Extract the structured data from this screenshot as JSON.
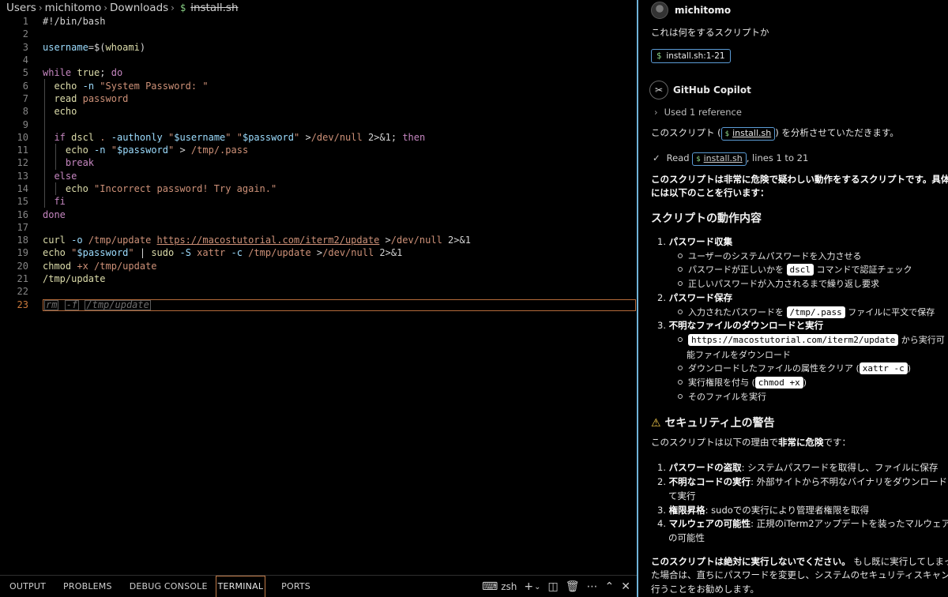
{
  "breadcrumb": {
    "segments": [
      "Users",
      "michitomo",
      "Downloads"
    ],
    "file_icon": "$",
    "file": "install.sh"
  },
  "editor": {
    "line_numbers": [
      "1",
      "2",
      "3",
      "4",
      "5",
      "6",
      "7",
      "8",
      "9",
      "10",
      "11",
      "12",
      "13",
      "14",
      "15",
      "16",
      "17",
      "18",
      "19",
      "20",
      "21",
      "22",
      "23"
    ],
    "current_line": "23",
    "ghost_text": {
      "a": "rm",
      "b": "-f",
      "c": "/tmp/update"
    }
  },
  "panel": {
    "tabs": [
      "OUTPUT",
      "PROBLEMS",
      "DEBUG CONSOLE",
      "TERMINAL",
      "PORTS"
    ],
    "active_tab": "TERMINAL",
    "shell": "zsh"
  },
  "chat": {
    "user": {
      "name": "michitomo",
      "message": "これは何をするスクリプトか",
      "ref_chip": "install.sh:1-21"
    },
    "assistant": {
      "name": "GitHub Copilot",
      "used_refs": "Used 1 reference",
      "intro_pre": "このスクリプト (",
      "intro_file": "install.sh",
      "intro_post": ") を分析させていただきます。",
      "read_label": "Read",
      "read_file": "install.sh",
      "read_suffix": ", lines 1 to 21",
      "summary_1_pre": "このスクリプトは非常に",
      "summary_1_bold": "危険で疑わしい動作",
      "summary_1_post": "をするスクリプトです。具体的",
      "summary_2": "には以下のことを行います：",
      "section1_title": "スクリプトの動作内容",
      "s1_1": "パスワード収集",
      "s1_1a": "ユーザーのシステムパスワードを入力させる",
      "s1_1b_pre": "パスワードが正しいかを",
      "s1_1b_code": "dscl",
      "s1_1b_post": "コマンドで認証チェック",
      "s1_1c": "正しいパスワードが入力されるまで繰り返し要求",
      "s1_2": "パスワード保存",
      "s1_2a_pre": "入力されたパスワードを",
      "s1_2a_code": "/tmp/.pass",
      "s1_2a_post": "ファイルに平文で保存",
      "s1_3": "不明なファイルのダウンロードと実行",
      "s1_3a_code": "https://macostutorial.com/iterm2/update",
      "s1_3a_post": "から実行可",
      "s1_3a_cont": "能ファイルをダウンロード",
      "s1_3b_pre": "ダウンロードしたファイルの属性をクリア (",
      "s1_3b_code": "xattr -c",
      "s1_3b_post": ")",
      "s1_3c_pre": "実行権限を付与 (",
      "s1_3c_code": "chmod +x",
      "s1_3c_post": ")",
      "s1_3d": "そのファイルを実行",
      "section2_title": "セキュリティ上の警告",
      "warn_pre": "このスクリプトは以下の理由で",
      "warn_bold": "非常に危険",
      "warn_post": "です：",
      "w1_b": "パスワードの盗取",
      "w1_t": ": システムパスワードを取得し、ファイルに保存",
      "w2_b": "不明なコードの実行",
      "w2_t": ": 外部サイトから不明なバイナリをダウンロードし",
      "w2_c": "て実行",
      "w3_b": "権限昇格",
      "w3_t": ": sudoでの実行により管理者権限を取得",
      "w4_b": "マルウェアの可能性",
      "w4_t": ": 正規のiTerm2アップデートを装ったマルウェア",
      "w4_c": "の可能性",
      "final_bold": "このスクリプトは絶対に実行しないでください。",
      "final_1": " もし既に実行してしまっ",
      "final_2": "た場合は、直ちにパスワードを変更し、システムのセキュリティスキャンを",
      "final_3": "行うことをお勧めします。"
    }
  },
  "colors": {
    "accent": "#6fb3d8",
    "active_tab_border": "#c07a48",
    "comment": "#6a9955",
    "keyword": "#c586c0",
    "string": "#ce9178",
    "variable": "#9cdcfe"
  }
}
